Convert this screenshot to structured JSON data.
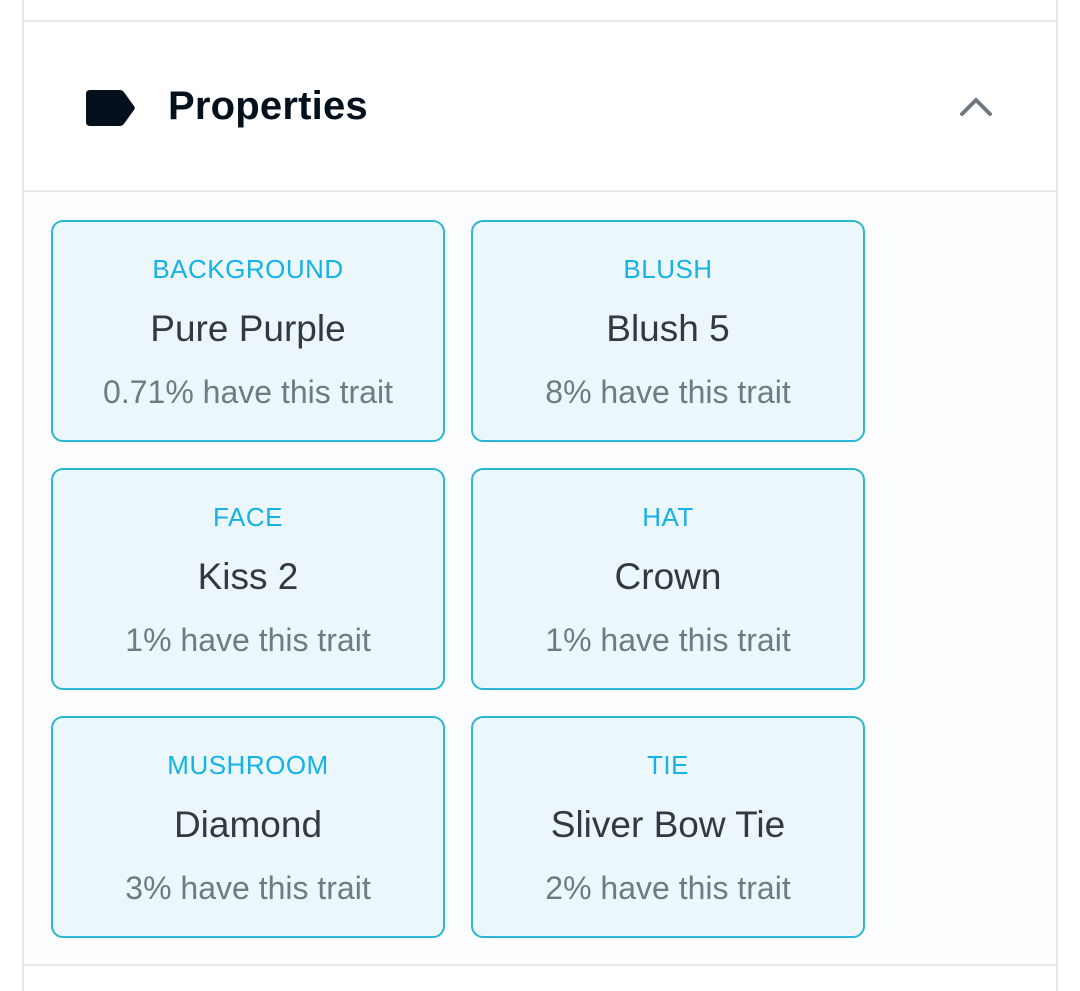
{
  "properties": {
    "title": "Properties",
    "icon": "label-tag-icon",
    "toggle_icon": "chevron-up-icon",
    "accent_color": "#15b2e5",
    "border_color": "#2bb6d2",
    "card_background": "#ebf7fb",
    "traits": [
      {
        "type": "BACKGROUND",
        "value": "Pure Purple",
        "rarity": "0.71% have this trait"
      },
      {
        "type": "BLUSH",
        "value": "Blush 5",
        "rarity": "8% have this trait"
      },
      {
        "type": "FACE",
        "value": "Kiss 2",
        "rarity": "1% have this trait"
      },
      {
        "type": "HAT",
        "value": "Crown",
        "rarity": "1% have this trait"
      },
      {
        "type": "MUSHROOM",
        "value": "Diamond",
        "rarity": "3% have this trait"
      },
      {
        "type": "TIE",
        "value": "Sliver Bow Tie",
        "rarity": "2% have this trait"
      }
    ]
  }
}
